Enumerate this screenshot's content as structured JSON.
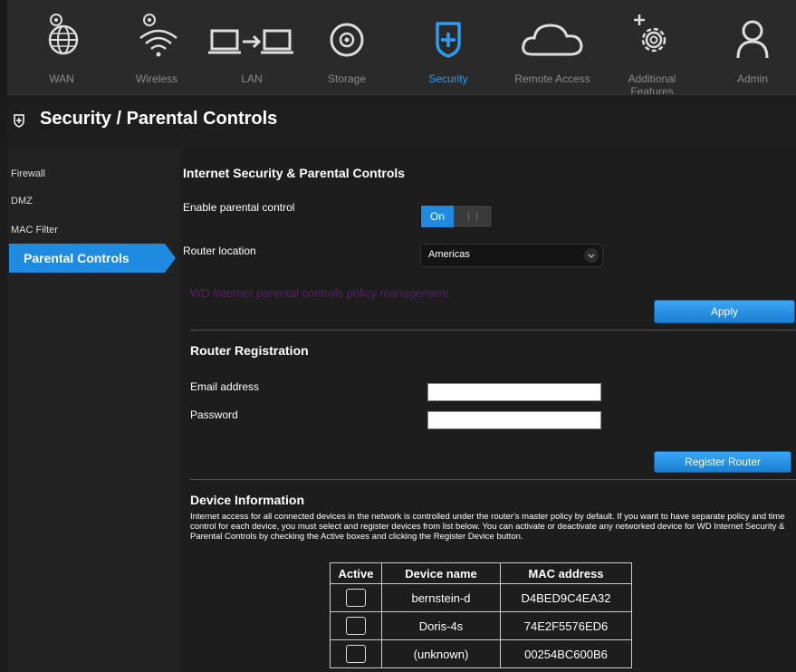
{
  "nav": {
    "items": [
      {
        "label": "WAN",
        "icon": "globe-gear-icon"
      },
      {
        "label": "Wireless",
        "icon": "wifi-gear-icon"
      },
      {
        "label": "LAN",
        "icon": "lan-icon"
      },
      {
        "label": "Storage",
        "icon": "disc-icon"
      },
      {
        "label": "Security",
        "icon": "shield-icon"
      },
      {
        "label": "Remote Access",
        "icon": "cloud-icon"
      },
      {
        "label": "Additional Features",
        "icon": "gear-plus-icon"
      },
      {
        "label": "Admin",
        "icon": "user-icon"
      }
    ],
    "active": "Security",
    "accent": "#2d9bf0"
  },
  "page": {
    "title": "Security / Parental Controls"
  },
  "sidebar": {
    "items": [
      {
        "label": "Firewall"
      },
      {
        "label": "DMZ"
      },
      {
        "label": "MAC Filter"
      },
      {
        "label": "Parental Controls"
      }
    ],
    "active": "Parental Controls"
  },
  "parental": {
    "heading": "Internet Security & Parental Controls",
    "enable_label": "Enable parental control",
    "toggle_on": "On",
    "location_label": "Router location",
    "location_value": "Americas",
    "policy_link": "WD Internet parental controls policy management",
    "apply_label": "Apply"
  },
  "registration": {
    "heading": "Router Registration",
    "email_label": "Email address",
    "email_value": "",
    "password_label": "Password",
    "password_value": "",
    "register_label": "Register Router"
  },
  "devices": {
    "heading": "Device Information",
    "description": "Internet access for all connected devices in the network is controlled under the router's master policy by default. If you want to have separate policy and time control for each device, you must select and register devices from list below. You can activate or deactivate any networked device for WD Internet Security & Parental Controls by checking the Active boxes and clicking the Register Device button.",
    "columns": [
      "Active",
      "Device name",
      "MAC address"
    ],
    "rows": [
      {
        "name": "bernstein-d",
        "mac": "D4BED9C4EA32",
        "active": false
      },
      {
        "name": "Doris-4s",
        "mac": "74E2F5576ED6",
        "active": false
      },
      {
        "name": "(unknown)",
        "mac": "00254BC600B6",
        "active": false
      }
    ]
  }
}
